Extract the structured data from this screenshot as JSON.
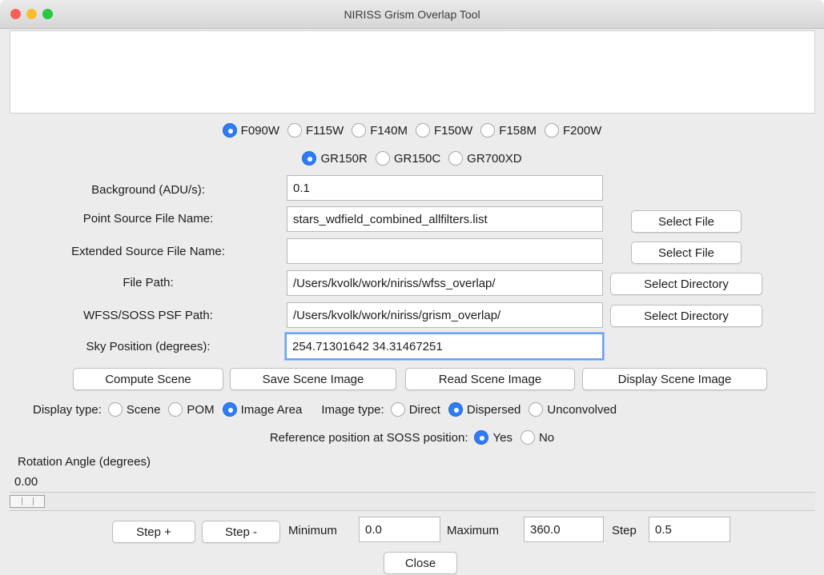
{
  "window": {
    "title": "NIRISS Grism Overlap Tool",
    "traffic_lights": {
      "close": "#fd5f57",
      "minimize": "#febc2e",
      "zoom": "#28c840"
    }
  },
  "filters": {
    "options": [
      "F090W",
      "F115W",
      "F140M",
      "F150W",
      "F158M",
      "F200W"
    ],
    "selected": "F090W"
  },
  "grisms": {
    "options": [
      "GR150R",
      "GR150C",
      "GR700XD"
    ],
    "selected": "GR150R"
  },
  "form": {
    "background_label": "Background (ADU/s):",
    "background_value": "0.1",
    "point_source_label": "Point Source File Name:",
    "point_source_value": "stars_wdfield_combined_allfilters.list",
    "extended_source_label": "Extended Source File Name:",
    "extended_source_value": "",
    "file_path_label": "File Path:",
    "file_path_value": "/Users/kvolk/work/niriss/wfss_overlap/",
    "psf_path_label": "WFSS/SOSS PSF Path:",
    "psf_path_value": "/Users/kvolk/work/niriss/grism_overlap/",
    "sky_position_label": "Sky Position (degrees):",
    "sky_position_value": "254.71301642 34.31467251",
    "select_file_label": "Select File",
    "select_directory_label": "Select Directory"
  },
  "actions": {
    "compute_scene": "Compute Scene",
    "save_scene_image": "Save Scene Image",
    "read_scene_image": "Read Scene Image",
    "display_scene_image": "Display Scene Image"
  },
  "display_type": {
    "label": "Display type:",
    "options": [
      "Scene",
      "POM",
      "Image Area"
    ],
    "selected": "Image Area"
  },
  "image_type": {
    "label": "Image type:",
    "options": [
      "Direct",
      "Dispersed",
      "Unconvolved"
    ],
    "selected": "Dispersed"
  },
  "reference_position": {
    "label": "Reference position at SOSS position:",
    "options": [
      "Yes",
      "No"
    ],
    "selected": "Yes"
  },
  "rotation": {
    "label": "Rotation Angle (degrees)",
    "value_text": "0.00",
    "slider_fraction": 0.0
  },
  "stepper": {
    "step_plus": "Step +",
    "step_minus": "Step -",
    "minimum_label": "Minimum",
    "minimum_value": "0.0",
    "maximum_label": "Maximum",
    "maximum_value": "360.0",
    "step_label": "Step",
    "step_value": "0.5"
  },
  "close_label": "Close"
}
